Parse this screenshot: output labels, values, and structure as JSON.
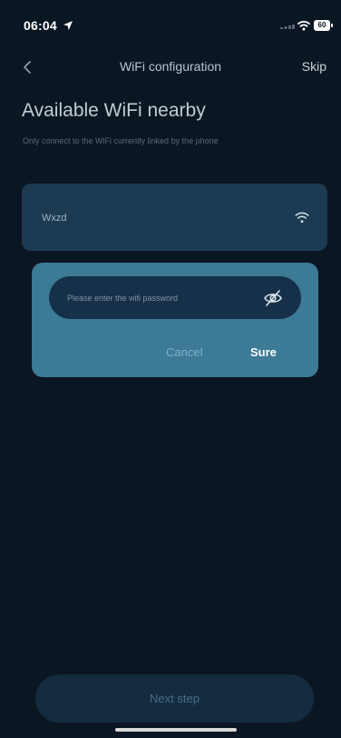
{
  "status_bar": {
    "time": "06:04",
    "battery_level": "60",
    "icons": [
      "location-arrow-icon",
      "cellular-signal-icon",
      "wifi-icon",
      "battery-icon"
    ]
  },
  "nav": {
    "title": "WiFi configuration",
    "skip_label": "Skip",
    "back_icon": "chevron-left-icon"
  },
  "heading": "Available WiFi nearby",
  "subtitle": "Only connect to the WiFi currently linked by the phone",
  "networks": [
    {
      "name": "Wxzd",
      "icon": "wifi-signal-icon"
    }
  ],
  "password_dialog": {
    "placeholder": "Please enter the wifi password",
    "value": "",
    "eye_icon": "eye-slash-icon",
    "cancel_label": "Cancel",
    "confirm_label": "Sure"
  },
  "footer": {
    "next_label": "Next step"
  },
  "colors": {
    "background": "#0b1623",
    "card": "#1c3b52",
    "dialog": "#3c7a96",
    "input": "#173049",
    "next_button": "#132c40"
  }
}
